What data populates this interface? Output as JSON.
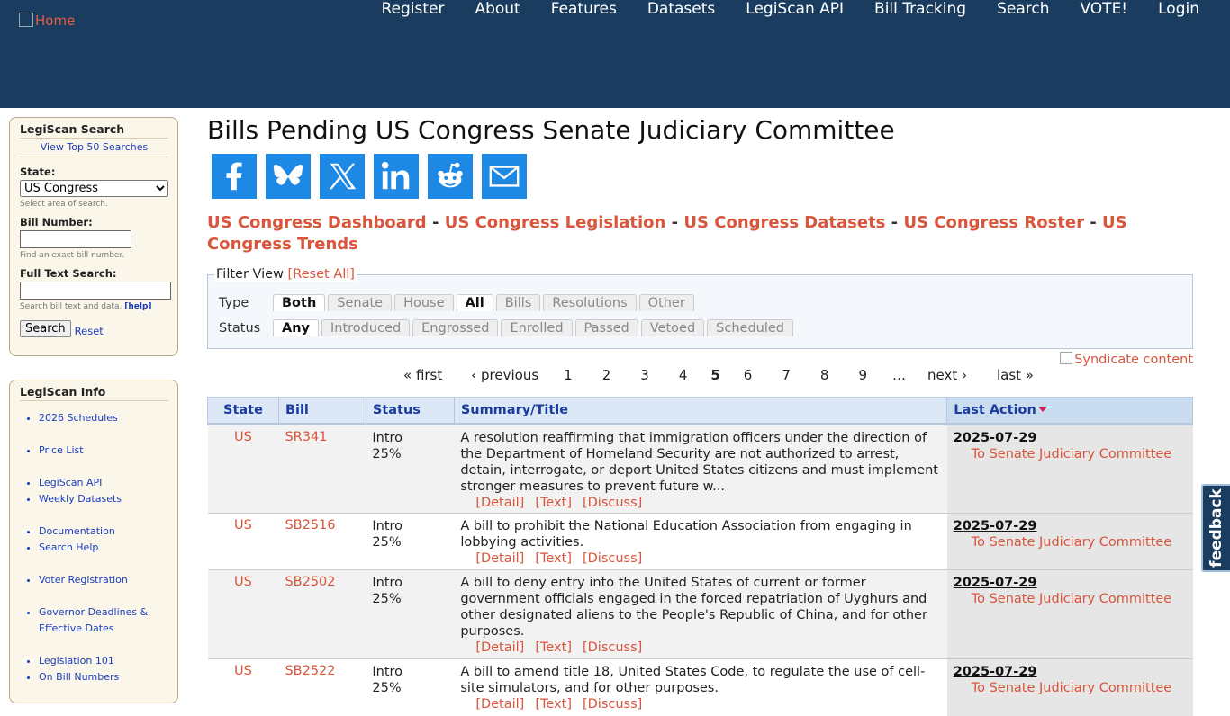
{
  "header": {
    "logo_alt": "Home",
    "nav": [
      "Register",
      "About",
      "Features",
      "Datasets",
      "LegiScan API",
      "Bill Tracking",
      "Search",
      "VOTE!",
      "Login"
    ],
    "colors": {
      "background": "#1a3d5f"
    }
  },
  "sidebar": {
    "search": {
      "title": "LegiScan Search",
      "top_link": "View Top 50 Searches",
      "state_label": "State:",
      "state_value": "US Congress",
      "state_hint": "Select area of search.",
      "bill_label": "Bill Number:",
      "bill_value": "",
      "bill_hint": "Find an exact bill number.",
      "fulltext_label": "Full Text Search:",
      "fulltext_value": "",
      "fulltext_hint": "Search bill text and data.",
      "help_link": "[help]",
      "search_button": "Search",
      "reset_link": "Reset"
    },
    "info": {
      "title": "LegiScan Info",
      "items": [
        "2026 Schedules",
        "Price List",
        "LegiScan API",
        "Weekly Datasets",
        "Documentation",
        "Search Help",
        "Voter Registration",
        "Governor Deadlines & Effective Dates",
        "Legislation 101",
        "On Bill Numbers"
      ]
    }
  },
  "main": {
    "title": "Bills Pending US Congress Senate Judiciary Committee",
    "share_icons": [
      "facebook-icon",
      "bluesky-icon",
      "x-icon",
      "linkedin-icon",
      "reddit-icon",
      "email-icon"
    ],
    "crumbs": [
      "US Congress Dashboard",
      "US Congress Legislation",
      "US Congress Datasets",
      "US Congress Roster",
      "US Congress Trends"
    ],
    "crumb_separator": "-",
    "filter": {
      "legend": "Filter View",
      "reset": "[Reset All]",
      "type_label": "Type",
      "type_options": [
        "Both",
        "Senate",
        "House",
        "All",
        "Bills",
        "Resolutions",
        "Other"
      ],
      "type_active": [
        "Both",
        "All"
      ],
      "status_label": "Status",
      "status_options": [
        "Any",
        "Introduced",
        "Engrossed",
        "Enrolled",
        "Passed",
        "Vetoed",
        "Scheduled"
      ],
      "status_active": [
        "Any"
      ]
    },
    "syndicate_alt": "Syndicate content",
    "pager": {
      "first": "« first",
      "previous": "‹ previous",
      "pages": [
        "1",
        "2",
        "3",
        "4",
        "5",
        "6",
        "7",
        "8",
        "9"
      ],
      "current": "5",
      "ellipsis": "…",
      "next": "next ›",
      "last": "last »"
    },
    "table": {
      "headers": {
        "state": "State",
        "bill": "Bill",
        "status": "Status",
        "summary": "Summary/Title",
        "last_action": "Last Action"
      },
      "row_links": {
        "detail": "[Detail]",
        "text": "[Text]",
        "discuss": "[Discuss]"
      },
      "rows": [
        {
          "state": "US",
          "bill": "SR341",
          "status": "Intro",
          "progress": "25%",
          "summary": "A resolution reaffirming that immigration officers under the direction of the Department of Homeland Security are not authorized to arrest, detain, interrogate, or deport United States citizens and must implement stronger measures to prevent future w...",
          "date": "2025-07-29",
          "action": "To Senate Judiciary Committee"
        },
        {
          "state": "US",
          "bill": "SB2516",
          "status": "Intro",
          "progress": "25%",
          "summary": "A bill to prohibit the National Education Association from engaging in lobbying activities.",
          "date": "2025-07-29",
          "action": "To Senate Judiciary Committee"
        },
        {
          "state": "US",
          "bill": "SB2502",
          "status": "Intro",
          "progress": "25%",
          "summary": "A bill to deny entry into the United States of current or former government officials engaged in the forced repatriation of Uyghurs and other designated aliens to the People's Republic of China, and for other purposes.",
          "date": "2025-07-29",
          "action": "To Senate Judiciary Committee"
        },
        {
          "state": "US",
          "bill": "SB2522",
          "status": "Intro",
          "progress": "25%",
          "summary": "A bill to amend title 18, United States Code, to regulate the use of cell-site simulators, and for other purposes.",
          "date": "2025-07-29",
          "action": "To Senate Judiciary Committee"
        }
      ]
    }
  },
  "feedback_tab": "feedback"
}
